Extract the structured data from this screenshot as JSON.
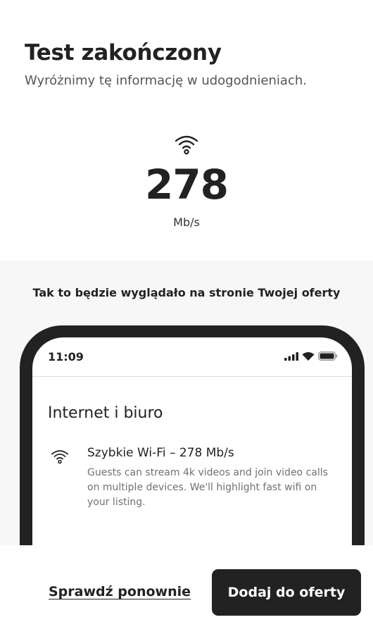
{
  "header": {
    "title": "Test zakończony",
    "subtitle": "Wyróżnimy tę informację w udogodnieniach."
  },
  "speed": {
    "icon": "wifi-icon",
    "value": "278",
    "unit": "Mb/s"
  },
  "preview": {
    "caption": "Tak to będzie wyglądało na stronie Twojej oferty",
    "phone": {
      "time": "11:09",
      "status_icons": [
        "signal-icon",
        "wifi-icon",
        "battery-icon"
      ],
      "heading": "Internet i biuro",
      "amenity": {
        "icon": "wifi-icon",
        "title": "Szybkie Wi-Fi – 278 Mb/s",
        "description": "Guests can stream 4k videos and join video calls on multiple devices. We'll highlight fast wifi on your listing."
      }
    }
  },
  "footer": {
    "retry_label": "Sprawdź ponownie",
    "add_label": "Dodaj do oferty"
  },
  "colors": {
    "text": "#222222",
    "muted": "#717171",
    "preview_bg": "#f7f7f7",
    "button_bg": "#222222"
  }
}
